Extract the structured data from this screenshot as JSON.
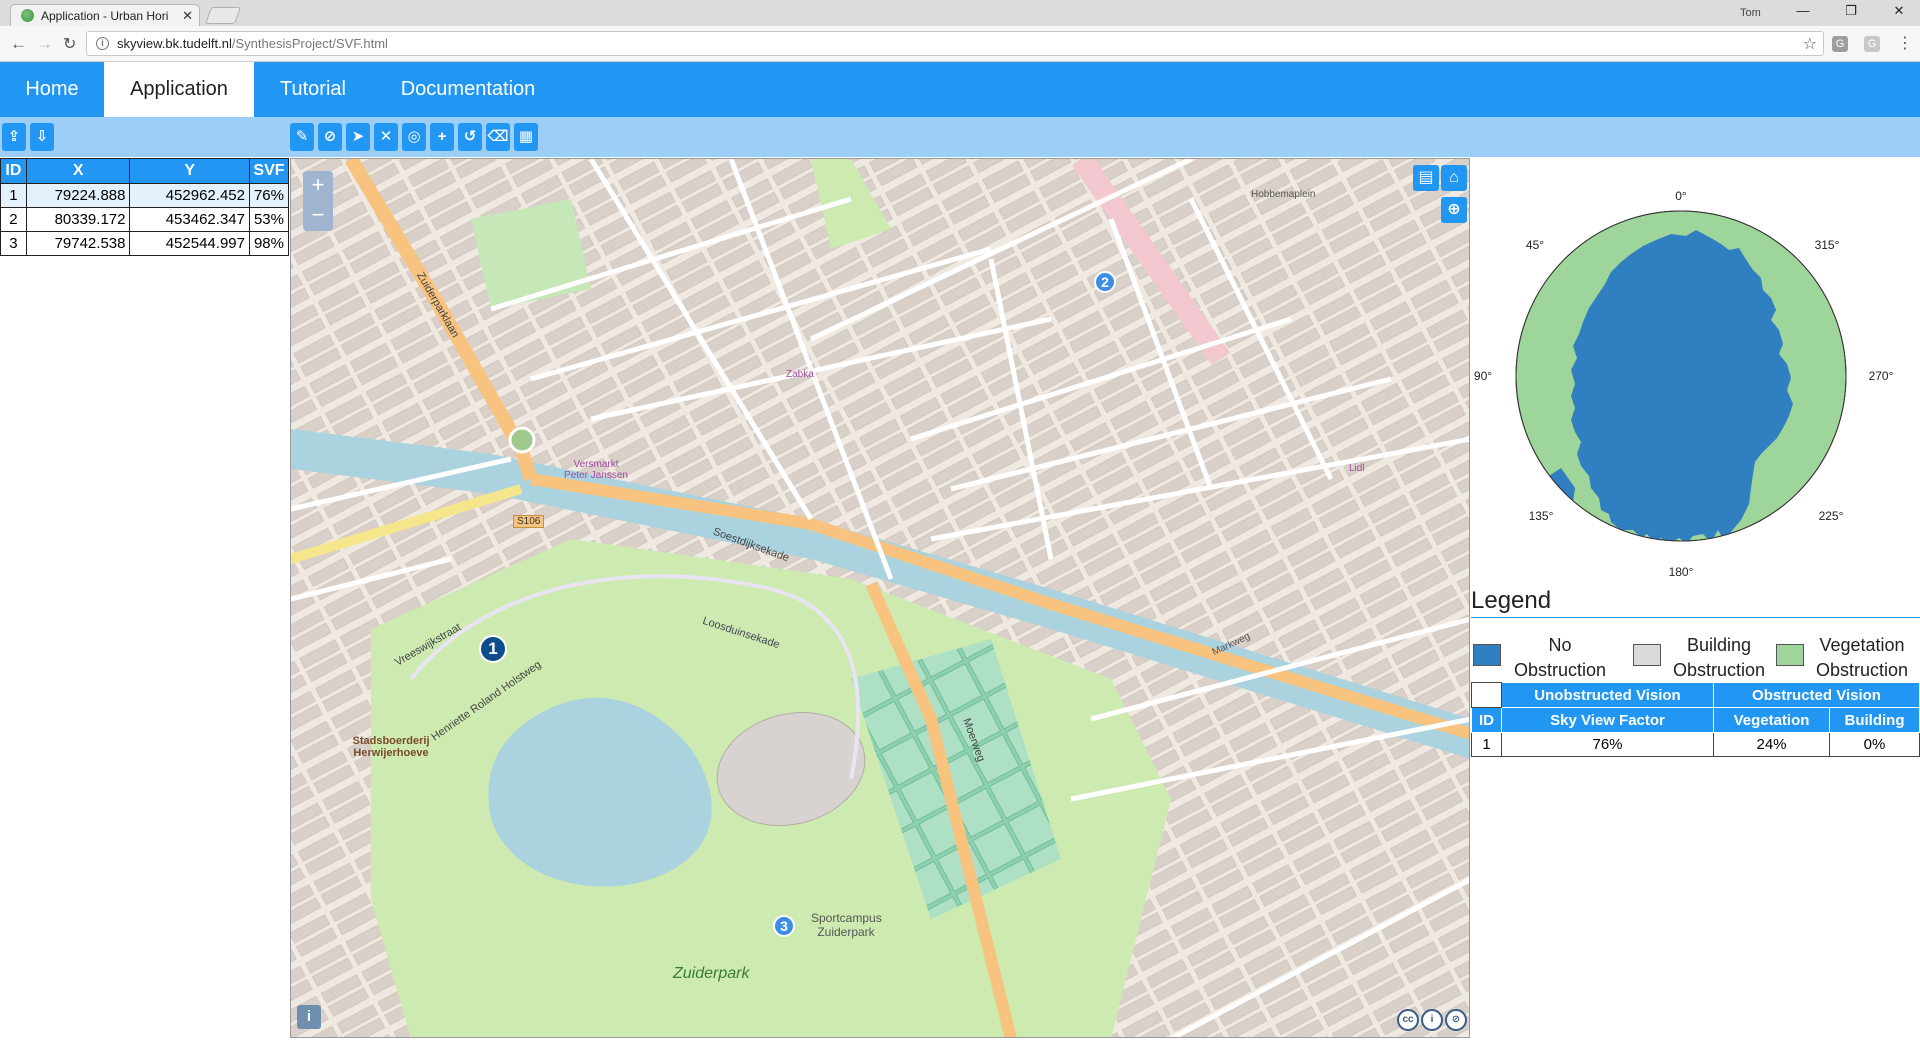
{
  "browser": {
    "tab_title": "Application - Urban Hori",
    "user": "Tom",
    "url_host": "skyview.bk.tudelft.nl",
    "url_path": "/SynthesisProject/SVF.html"
  },
  "navbar": {
    "tabs": [
      {
        "label": "Home"
      },
      {
        "label": "Application",
        "active": true
      },
      {
        "label": "Tutorial"
      },
      {
        "label": "Documentation"
      }
    ]
  },
  "coords_table": {
    "headers": [
      "ID",
      "X",
      "Y",
      "SVF"
    ],
    "rows": [
      {
        "id": "1",
        "x": "79224.888",
        "y": "452962.452",
        "svf": "76%"
      },
      {
        "id": "2",
        "x": "80339.172",
        "y": "453462.347",
        "svf": "53%"
      },
      {
        "id": "3",
        "x": "79742.538",
        "y": "452544.997",
        "svf": "98%"
      }
    ]
  },
  "map": {
    "markers": [
      "1",
      "2",
      "3"
    ],
    "labels": {
      "soestdijksekade": "Soestdijksekade",
      "zuiderpark": "Zuiderpark",
      "zuiderparklaan": "Zuiderparklaan",
      "s106": "S106",
      "moerweg": "Moerweg",
      "henriette": "Henriette Roland Holstweg",
      "sportcampus": "Sportcampus Zuiderpark",
      "stadsboerderij": "Stadsboerderij Herwijerhoeve",
      "vreeswijkstraat": "Vreeswijkstraat",
      "lorentzkanaal": "Loosduinsekade",
      "hobbemaplein": "Hobbemaplein",
      "markweg": "Markweg",
      "versmarkt": "Versmarkt Peter Janssen",
      "zabka": "Zabka",
      "lidl": "Lidl"
    }
  },
  "polar": {
    "angles": {
      "top": "0°",
      "tl": "45°",
      "tr": "315°",
      "left": "90°",
      "right": "270°",
      "bl": "135°",
      "br": "225°",
      "bottom": "180°"
    }
  },
  "legend": {
    "title": "Legend",
    "items": [
      {
        "label_1": "No",
        "label_2": "Obstruction",
        "color": "#2f7fc1"
      },
      {
        "label_1": "Building",
        "label_2": "Obstruction",
        "color": "#d9d9d9"
      },
      {
        "label_1": "Vegetation",
        "label_2": "Obstruction",
        "color": "#9ed59a"
      }
    ]
  },
  "svf_table": {
    "group_unobstructed": "Unobstructed Vision",
    "group_obstructed": "Obstructed Vision",
    "col_id": "ID",
    "col_svf": "Sky View Factor",
    "col_veg": "Vegetation",
    "col_bld": "Building",
    "row": {
      "id": "1",
      "svf": "76%",
      "veg": "24%",
      "bld": "0%"
    }
  },
  "colors": {
    "accent": "#2196f3",
    "toolbar": "#9ccef8",
    "sky": "#2f7fc1",
    "vegetation": "#9ed59a"
  }
}
